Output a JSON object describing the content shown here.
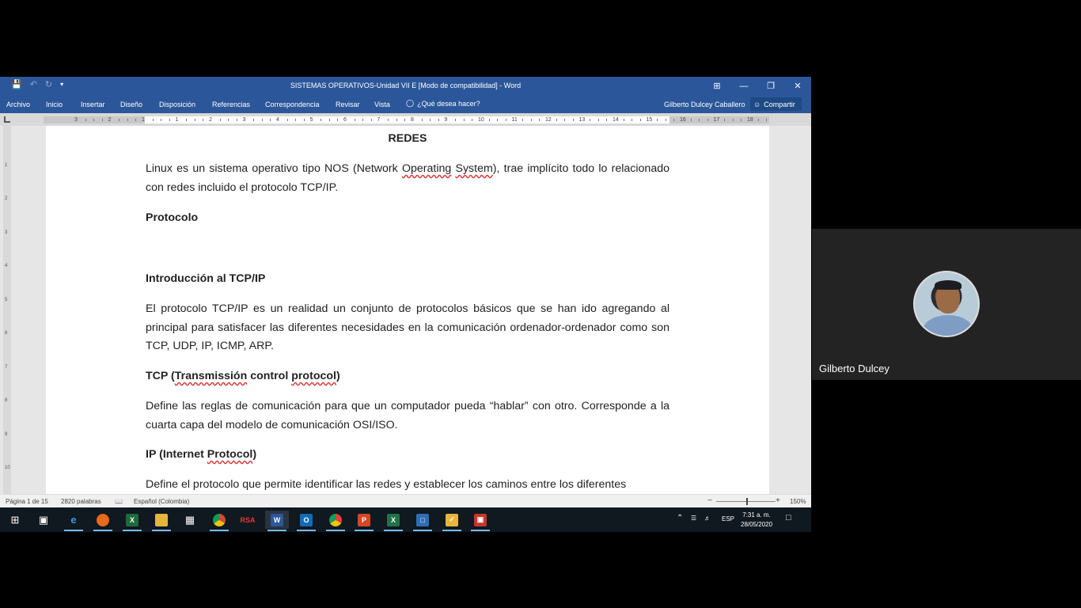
{
  "word": {
    "title": "SISTEMAS OPERATIVOS-Unidad VII E [Modo de compatibilidad] - Word",
    "window_controls": [
      "⊞",
      "—",
      "❐",
      "✕"
    ],
    "tabs": [
      "Archivo",
      "Inicio",
      "Insertar",
      "Diseño",
      "Disposición",
      "Referencias",
      "Correspondencia",
      "Revisar",
      "Vista"
    ],
    "tell_me": "¿Qué desea hacer?",
    "user": "Gilberto Dulcey Caballero",
    "share": "Compartir",
    "ruler_numbers": [
      "3",
      "2",
      "1",
      "1",
      "2",
      "3",
      "4",
      "5",
      "6",
      "7",
      "8",
      "9",
      "10",
      "11",
      "12",
      "13",
      "14",
      "15",
      "16",
      "17",
      "18"
    ],
    "vruler_numbers": [
      "1",
      "2",
      "3",
      "4",
      "5",
      "6",
      "7",
      "8",
      "9",
      "10",
      "11"
    ]
  },
  "document": {
    "heading": "REDES",
    "p1": {
      "a": "Linux es un sistema operativo tipo NOS (Network ",
      "b": "Operating",
      "c": " ",
      "d": "System",
      "e": "), trae implícito todo lo relacionado con redes incluido el protocolo TCP/IP."
    },
    "h_protocolo": "Protocolo",
    "h_intro": "Introducción al TCP/IP",
    "p2": "El protocolo TCP/IP es un realidad un conjunto de protocolos básicos que se han ido agregando  al principal para satisfacer las diferentes necesidades en la comunicación ordenador-ordenador como son TCP, UDP, IP, ICMP, ARP.",
    "h_tcp": {
      "a": "TCP (",
      "b": "Transmissión",
      "c": "  control ",
      "d": "protocol",
      "e": ")"
    },
    "p3": "Define las reglas de comunicación para que un computador pueda “hablar” con otro. Corresponde a la cuarta capa del modelo de comunicación OSI/ISO.",
    "h_ip": {
      "a": "IP (Internet ",
      "b": "Protocol",
      "c": ")"
    },
    "p4": "Define el protocolo que permite identificar las redes y establecer los caminos entre los diferentes"
  },
  "status": {
    "page": "Página 1 de 15",
    "words": "2820 palabras",
    "language": "Español (Colombia)",
    "zoom_minus": "−",
    "zoom_plus": "+",
    "zoom": "150%",
    "zoom_level_percent": 50
  },
  "taskbar": {
    "apps": [
      "windows-start",
      "task-view",
      "edge",
      "firefox",
      "app-x",
      "file-explorer",
      "calculator",
      "chrome",
      "rsa",
      "word",
      "outlook",
      "chrome-2",
      "powerpoint",
      "excel",
      "virtualbox",
      "app-tool",
      "app-red"
    ],
    "rsa_label": "RSA",
    "tray_lang": "ESP",
    "time": "7:31 a. m.",
    "date": "28/05/2020"
  },
  "participant": {
    "name": "Gilberto Dulcey"
  }
}
